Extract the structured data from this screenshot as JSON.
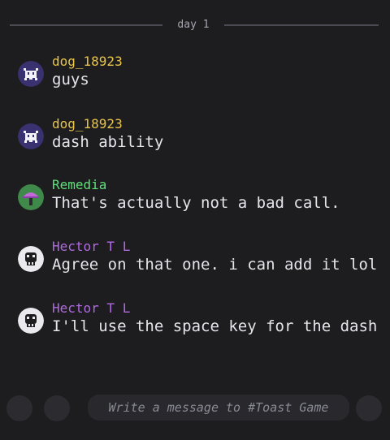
{
  "divider": {
    "label": "day 1"
  },
  "messages": [
    {
      "author": "dog_18923",
      "text": "guys",
      "author_color": "#e8c54a",
      "avatar": "crab-icon"
    },
    {
      "author": "dog_18923",
      "text": "dash ability",
      "author_color": "#e8c54a",
      "avatar": "crab-icon"
    },
    {
      "author": "Remedia",
      "text": "That's actually not a bad call.",
      "author_color": "#5fe07a",
      "avatar": "mushroom-icon"
    },
    {
      "author": "Hector T L",
      "text": "Agree on that one. i can add it lol",
      "author_color": "#b06ae0",
      "avatar": "skull-icon"
    },
    {
      "author": "Hector T L",
      "text": "I'll use the space key for the dash",
      "author_color": "#b06ae0",
      "avatar": "skull-icon"
    }
  ],
  "composer": {
    "placeholder": "Write a message to #Toast Game"
  },
  "colors": {
    "background": "#1d1d20",
    "text": "#e4e4ea"
  }
}
